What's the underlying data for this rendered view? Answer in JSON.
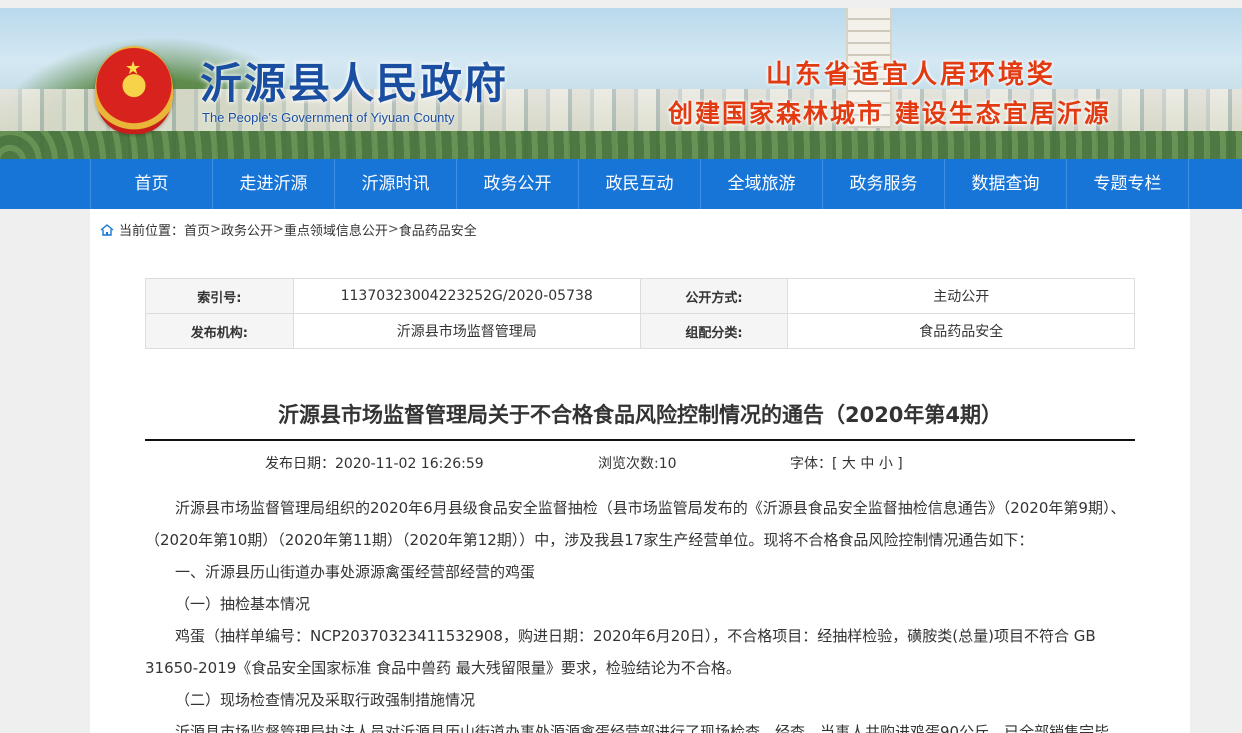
{
  "header": {
    "title": "沂源县人民政府",
    "subtitle": "The People's Government of Yiyuan County",
    "slogan_line1": "山东省适宜人居环境奖",
    "slogan_line2": "创建国家森林城市  建设生态宜居沂源"
  },
  "nav": {
    "items": [
      "首页",
      "走进沂源",
      "沂源时讯",
      "政务公开",
      "政民互动",
      "全域旅游",
      "政务服务",
      "数据查询",
      "专题专栏"
    ]
  },
  "breadcrumb": {
    "prefix": "当前位置：",
    "items": [
      "首页",
      "政务公开",
      "重点领域信息公开",
      "食品药品安全"
    ],
    "separator": ">"
  },
  "meta": {
    "index_label": "索引号:",
    "index_value": "11370323004223252G/2020-05738",
    "public_label": "公开方式:",
    "public_value": "主动公开",
    "org_label": "发布机构:",
    "org_value": "沂源县市场监督管理局",
    "category_label": "组配分类:",
    "category_value": "食品药品安全"
  },
  "article": {
    "title": "沂源县市场监督管理局关于不合格食品风险控制情况的通告（2020年第4期）",
    "date": "发布日期：2020-11-02 16:26:59",
    "views": "浏览次数:10",
    "font_label": "字体：[",
    "font_large": "大",
    "font_medium": "中",
    "font_small": "小",
    "font_end": "]",
    "paragraphs": [
      "沂源县市场监督管理局组织的2020年6月县级食品安全监督抽检（县市场监管局发布的《沂源县食品安全监督抽检信息通告》（2020年第9期）、（2020年第10期）（2020年第11期）（2020年第12期））中，涉及我县17家生产经营单位。现将不合格食品风险控制情况通告如下：",
      "一、沂源县历山街道办事处源源禽蛋经营部经营的鸡蛋",
      "（一）抽检基本情况",
      "鸡蛋（抽样单编号：NCP20370323411532908，购进日期：2020年6月20日），不合格项目：经抽样检验，磺胺类(总量)项目不符合 GB 31650-2019《食品安全国家标准 食品中兽药 最大残留限量》要求，检验结论为不合格。",
      "（二）现场检查情况及采取行政强制措施情况",
      "沂源县市场监督管理局执法人员对沂源县历山街道办事处源源禽蛋经营部进行了现场检查，经查，当事人共购进鸡蛋90公斤，已全部销售完毕。"
    ]
  }
}
